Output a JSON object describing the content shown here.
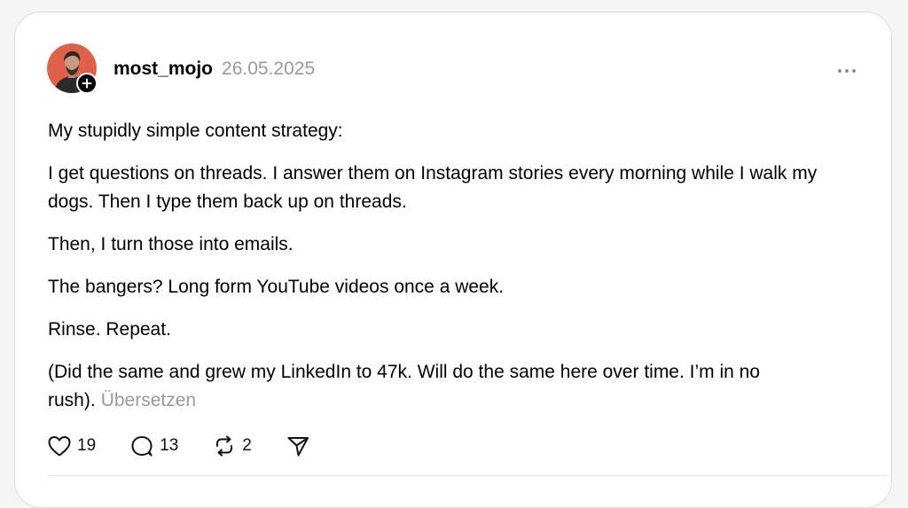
{
  "post": {
    "username": "most_mojo",
    "date": "26.05.2025",
    "paragraphs": [
      "My stupidly simple content strategy:",
      "I get questions on threads. I answer them on Instagram stories every morning while I walk my dogs. Then I type them back up on threads.",
      "Then, I turn those into emails.",
      "The bangers? Long form YouTube videos once a week.",
      "Rinse. Repeat.",
      "(Did the same and grew my LinkedIn to 47k. Will do the same here over time. I’m in no rush)."
    ],
    "translate_label": "Übersetzen"
  },
  "actions": {
    "likes": "19",
    "replies": "13",
    "reposts": "2"
  },
  "icons": {
    "like": "heart-icon",
    "reply": "comment-icon",
    "repost": "repost-icon",
    "share": "send-icon",
    "more": "more-horizontal-icon",
    "follow": "plus-icon"
  },
  "colors": {
    "avatar_bg": "#e0614a",
    "muted_text": "#999999"
  }
}
